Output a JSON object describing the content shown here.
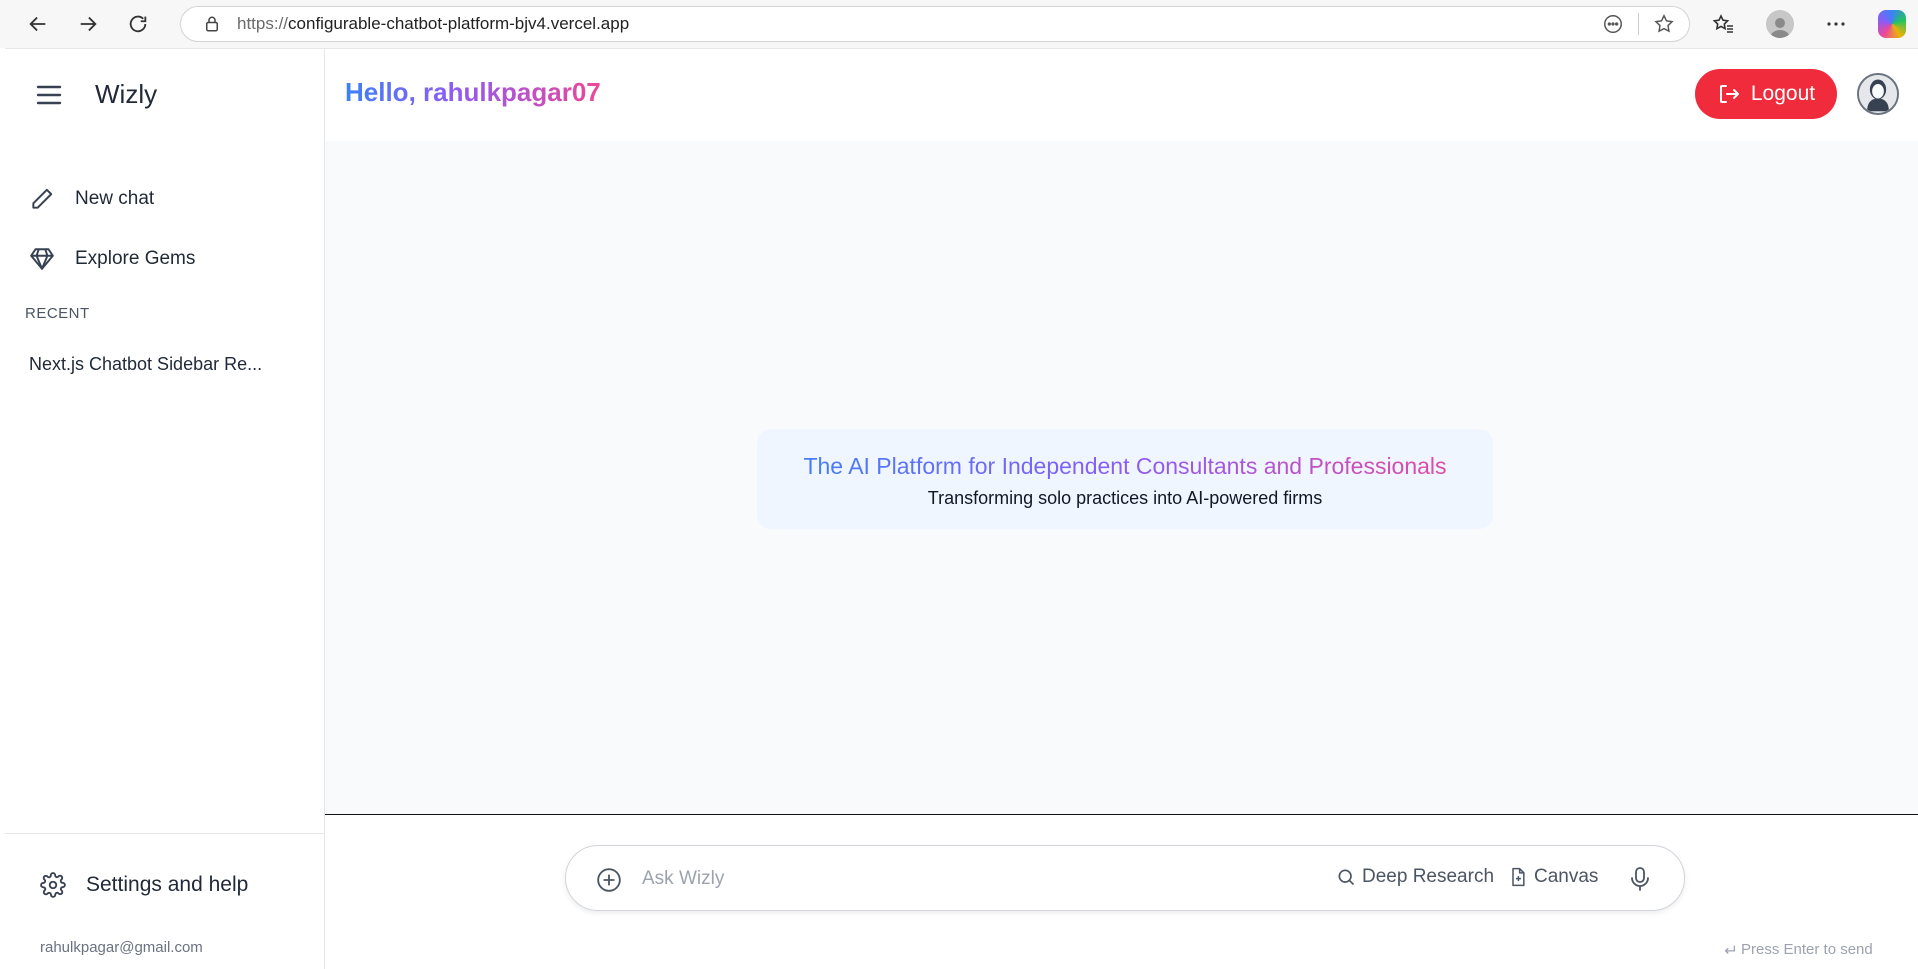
{
  "browser": {
    "url_protocol": "https://",
    "url_host": "configurable-chatbot-platform-bjv4.vercel.app"
  },
  "sidebar": {
    "brand": "Wizly",
    "items": [
      {
        "label": "New chat",
        "icon": "pencil-icon"
      },
      {
        "label": "Explore Gems",
        "icon": "gem-icon"
      }
    ],
    "recent_heading": "RECENT",
    "recent_items": [
      "Next.js Chatbot Sidebar Re..."
    ],
    "settings_label": "Settings and help",
    "user_email": "rahulkpagar@gmail.com"
  },
  "header": {
    "greeting": "Hello, rahulkpagar07",
    "logout_label": "Logout"
  },
  "hero": {
    "title": "The AI Platform for Independent Consultants and Professionals",
    "subtitle": "Transforming solo practices into AI-powered firms"
  },
  "composer": {
    "placeholder": "Ask Wizly",
    "deep_research_label": "Deep Research",
    "canvas_label": "Canvas",
    "send_hint": "Press Enter to send"
  },
  "colors": {
    "logout": "#ef2b3c",
    "gradient_start": "#3b82f6",
    "gradient_mid": "#8b5cf6",
    "gradient_end": "#ec4899",
    "hero_bg": "#eff6ff"
  }
}
